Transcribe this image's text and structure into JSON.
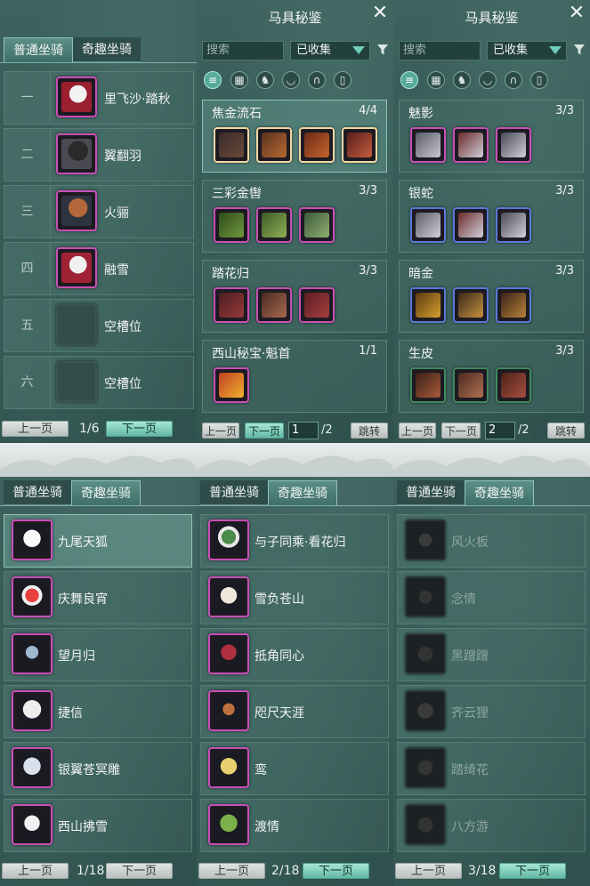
{
  "colors": {
    "accent": "#63b8a4",
    "rare_border": "#c94fb5",
    "blue_border": "#5a78d8"
  },
  "left_top": {
    "tabs": [
      "普通坐骑",
      "奇趣坐骑"
    ],
    "slots": [
      {
        "num": "一",
        "name": "里飞沙·踏秋",
        "icon": "white-horse-icon"
      },
      {
        "num": "二",
        "name": "翼翻羽",
        "icon": "black-horse-icon"
      },
      {
        "num": "三",
        "name": "火骊",
        "icon": "chestnut-horse-icon"
      },
      {
        "num": "四",
        "name": "融雪",
        "icon": "white-horse-icon"
      },
      {
        "num": "五",
        "name": "空槽位",
        "icon": "empty-slot-icon"
      },
      {
        "num": "六",
        "name": "空槽位",
        "icon": "empty-slot-icon"
      }
    ],
    "pager": {
      "prev": "上一页",
      "page": "1/6",
      "next": "下一页"
    }
  },
  "gear1": {
    "title": "马具秘鉴",
    "search_placeholder": "搜索",
    "filter_value": "已收集",
    "sets": [
      {
        "name": "焦金流石",
        "count": "4/4",
        "items": 4
      },
      {
        "name": "三彩金辔",
        "count": "3/3",
        "items": 3
      },
      {
        "name": "踏花归",
        "count": "3/3",
        "items": 3
      },
      {
        "name": "西山秘宝·魁首",
        "count": "1/1",
        "items": 1
      }
    ],
    "pager": {
      "prev": "上一页",
      "next": "下一页",
      "page": "1",
      "total": "/2",
      "jump": "跳转"
    }
  },
  "gear2": {
    "title": "马具秘鉴",
    "search_placeholder": "搜索",
    "filter_value": "已收集",
    "sets": [
      {
        "name": "魅影",
        "count": "3/3",
        "items": 3
      },
      {
        "name": "银蛇",
        "count": "3/3",
        "items": 3
      },
      {
        "name": "暗金",
        "count": "3/3",
        "items": 3
      },
      {
        "name": "生皮",
        "count": "3/3",
        "items": 3
      }
    ],
    "pager": {
      "prev": "上一页",
      "next": "下一页",
      "page": "2",
      "total": "/2",
      "jump": "跳转"
    }
  },
  "fun1": {
    "tabs": [
      "普通坐骑",
      "奇趣坐骑"
    ],
    "items": [
      "九尾天狐",
      "庆舞良宵",
      "望月归",
      "捷信",
      "银翼苍冥雕",
      "西山拂雪"
    ],
    "pager": {
      "prev": "上一页",
      "page": "1/18",
      "next": "下一页"
    }
  },
  "fun2": {
    "tabs": [
      "普通坐骑",
      "奇趣坐骑"
    ],
    "items": [
      "与子同乘·看花归",
      "雪负苍山",
      "抵角同心",
      "咫尺天涯",
      "鸾",
      "渡情"
    ],
    "pager": {
      "prev": "上一页",
      "page": "2/18",
      "next": "下一页"
    }
  },
  "fun3": {
    "tabs": [
      "普通坐骑",
      "奇趣坐骑"
    ],
    "items": [
      "风火板",
      "念情",
      "黑蹭蹭",
      "齐云狸",
      "踏绮花",
      "八方游"
    ],
    "pager": {
      "prev": "上一页",
      "page": "3/18",
      "next": "下一页"
    }
  }
}
